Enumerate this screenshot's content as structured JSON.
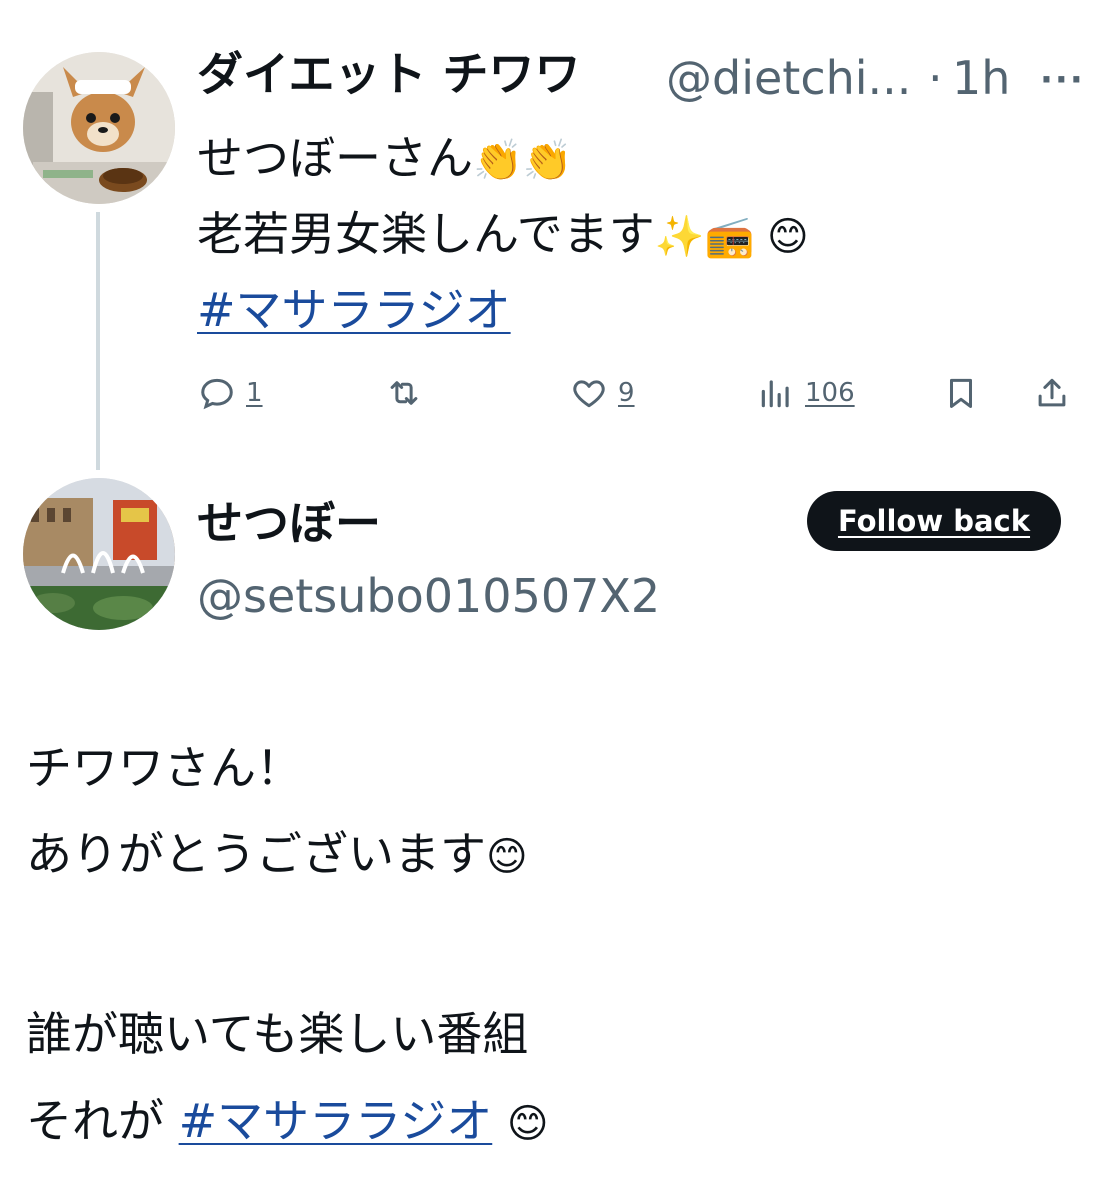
{
  "parent_tweet": {
    "display_name": "ダイエット チワワ",
    "handle": "@dietchi...",
    "separator": "·",
    "time": "1h",
    "more_label": "···",
    "lines": [
      {
        "text": "せつぼーさん",
        "emoji": "👏👏"
      },
      {
        "text": "老若男女楽しんでます",
        "emoji": "✨📻 😊"
      }
    ],
    "hashtag": "#マサララジオ",
    "actions": {
      "reply_count": "1",
      "like_count": "9",
      "views_count": "106"
    },
    "icons": [
      "reply-icon",
      "retweet-icon",
      "heart-icon",
      "views-icon",
      "bookmark-icon",
      "share-icon"
    ]
  },
  "reply": {
    "display_name": "せつぼー",
    "handle": "@setsubo010507X2",
    "follow_label": "Follow back",
    "lines": [
      {
        "text": "チワワさん！",
        "emoji": ""
      },
      {
        "text": "ありがとうございます",
        "emoji": "😊"
      },
      {
        "text": "誰が聴いても楽しい番組",
        "emoji": ""
      },
      {
        "text": "それが",
        "emoji": "😊"
      }
    ],
    "hashtag": "#マサララジオ"
  },
  "colors": {
    "text": "#0f1419",
    "muted": "#536471",
    "link": "#1a4b9c",
    "button_bg": "#0f1419",
    "thread_line": "#cfd9de"
  }
}
